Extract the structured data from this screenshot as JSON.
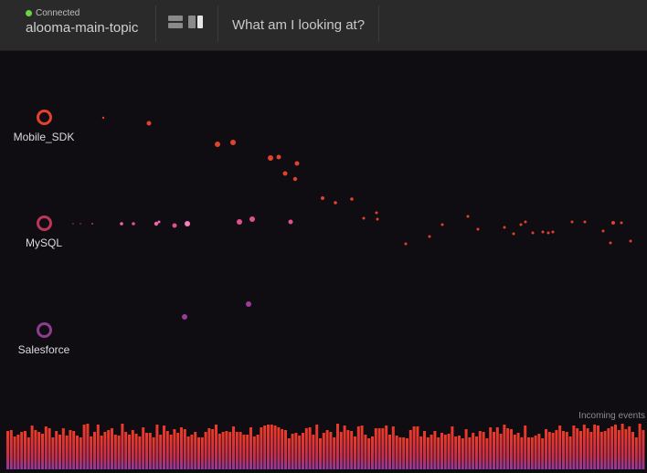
{
  "header": {
    "status": "Connected",
    "topic": "alooma-main-topic",
    "help_link": "What am I looking at?"
  },
  "sources": [
    {
      "label": "Mobile_SDK",
      "color": "#e2412c"
    },
    {
      "label": "MySQL",
      "color": "#b8375a"
    },
    {
      "label": "Salesforce",
      "color": "#8e3d8e"
    }
  ],
  "footer": {
    "incoming_label": "Incoming events"
  },
  "colors": {
    "connected": "#6ad443",
    "bar_top": "#ee3b26",
    "bar_bottom": "#8e3aa0",
    "background": "#0f0c12"
  },
  "icons": [
    "stacked-layout-icon",
    "columns-layout-icon"
  ]
}
